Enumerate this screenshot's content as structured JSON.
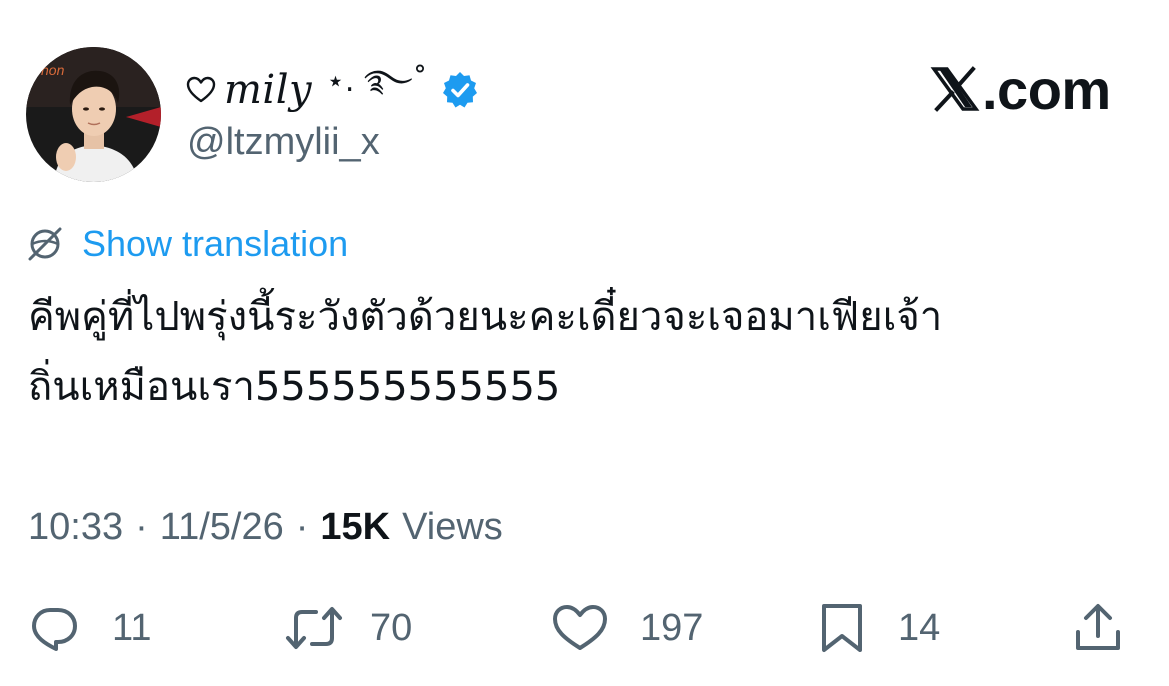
{
  "author": {
    "display_name": "mily",
    "name_decoration": "⋆. ࿐˚",
    "handle": "@ltzmylii_x",
    "verified": true
  },
  "brand": {
    "site": ".com",
    "logo_icon": "x-logo-icon"
  },
  "translation": {
    "label": "Show translation",
    "icon": "globe-slash-icon"
  },
  "tweet": {
    "text_line1": "คีพคู่ที่ไปพรุ่งนี้ระวังตัวด้วยนะคะเดี๋ยวจะเจอมาเฟียเจ้า",
    "text_line2": "ถิ่นเหมือนเรา555555555555"
  },
  "meta": {
    "time": "10:33",
    "separator": "·",
    "date": "11/5/26",
    "views_count": "15K",
    "views_label": "Views"
  },
  "actions": {
    "reply": {
      "icon": "reply-icon",
      "count": "11"
    },
    "retweet": {
      "icon": "retweet-icon",
      "count": "70"
    },
    "like": {
      "icon": "heart-icon",
      "count": "197"
    },
    "bookmark": {
      "icon": "bookmark-icon",
      "count": "14"
    },
    "share": {
      "icon": "share-icon"
    }
  },
  "colors": {
    "link_blue": "#1d9bf0",
    "secondary_text": "#536471",
    "primary_text": "#0f1419"
  }
}
